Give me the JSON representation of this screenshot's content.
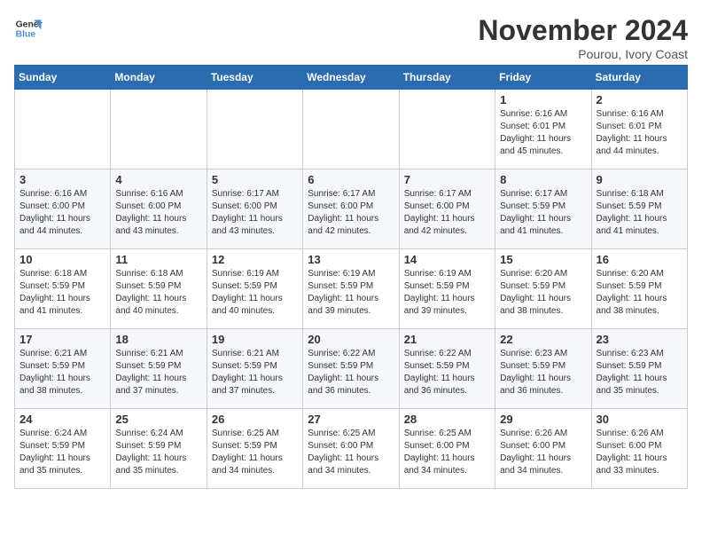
{
  "logo": {
    "line1": "General",
    "line2": "Blue"
  },
  "title": "November 2024",
  "location": "Pourou, Ivory Coast",
  "weekdays": [
    "Sunday",
    "Monday",
    "Tuesday",
    "Wednesday",
    "Thursday",
    "Friday",
    "Saturday"
  ],
  "weeks": [
    [
      {
        "day": "",
        "info": ""
      },
      {
        "day": "",
        "info": ""
      },
      {
        "day": "",
        "info": ""
      },
      {
        "day": "",
        "info": ""
      },
      {
        "day": "",
        "info": ""
      },
      {
        "day": "1",
        "info": "Sunrise: 6:16 AM\nSunset: 6:01 PM\nDaylight: 11 hours\nand 45 minutes."
      },
      {
        "day": "2",
        "info": "Sunrise: 6:16 AM\nSunset: 6:01 PM\nDaylight: 11 hours\nand 44 minutes."
      }
    ],
    [
      {
        "day": "3",
        "info": "Sunrise: 6:16 AM\nSunset: 6:00 PM\nDaylight: 11 hours\nand 44 minutes."
      },
      {
        "day": "4",
        "info": "Sunrise: 6:16 AM\nSunset: 6:00 PM\nDaylight: 11 hours\nand 43 minutes."
      },
      {
        "day": "5",
        "info": "Sunrise: 6:17 AM\nSunset: 6:00 PM\nDaylight: 11 hours\nand 43 minutes."
      },
      {
        "day": "6",
        "info": "Sunrise: 6:17 AM\nSunset: 6:00 PM\nDaylight: 11 hours\nand 42 minutes."
      },
      {
        "day": "7",
        "info": "Sunrise: 6:17 AM\nSunset: 6:00 PM\nDaylight: 11 hours\nand 42 minutes."
      },
      {
        "day": "8",
        "info": "Sunrise: 6:17 AM\nSunset: 5:59 PM\nDaylight: 11 hours\nand 41 minutes."
      },
      {
        "day": "9",
        "info": "Sunrise: 6:18 AM\nSunset: 5:59 PM\nDaylight: 11 hours\nand 41 minutes."
      }
    ],
    [
      {
        "day": "10",
        "info": "Sunrise: 6:18 AM\nSunset: 5:59 PM\nDaylight: 11 hours\nand 41 minutes."
      },
      {
        "day": "11",
        "info": "Sunrise: 6:18 AM\nSunset: 5:59 PM\nDaylight: 11 hours\nand 40 minutes."
      },
      {
        "day": "12",
        "info": "Sunrise: 6:19 AM\nSunset: 5:59 PM\nDaylight: 11 hours\nand 40 minutes."
      },
      {
        "day": "13",
        "info": "Sunrise: 6:19 AM\nSunset: 5:59 PM\nDaylight: 11 hours\nand 39 minutes."
      },
      {
        "day": "14",
        "info": "Sunrise: 6:19 AM\nSunset: 5:59 PM\nDaylight: 11 hours\nand 39 minutes."
      },
      {
        "day": "15",
        "info": "Sunrise: 6:20 AM\nSunset: 5:59 PM\nDaylight: 11 hours\nand 38 minutes."
      },
      {
        "day": "16",
        "info": "Sunrise: 6:20 AM\nSunset: 5:59 PM\nDaylight: 11 hours\nand 38 minutes."
      }
    ],
    [
      {
        "day": "17",
        "info": "Sunrise: 6:21 AM\nSunset: 5:59 PM\nDaylight: 11 hours\nand 38 minutes."
      },
      {
        "day": "18",
        "info": "Sunrise: 6:21 AM\nSunset: 5:59 PM\nDaylight: 11 hours\nand 37 minutes."
      },
      {
        "day": "19",
        "info": "Sunrise: 6:21 AM\nSunset: 5:59 PM\nDaylight: 11 hours\nand 37 minutes."
      },
      {
        "day": "20",
        "info": "Sunrise: 6:22 AM\nSunset: 5:59 PM\nDaylight: 11 hours\nand 36 minutes."
      },
      {
        "day": "21",
        "info": "Sunrise: 6:22 AM\nSunset: 5:59 PM\nDaylight: 11 hours\nand 36 minutes."
      },
      {
        "day": "22",
        "info": "Sunrise: 6:23 AM\nSunset: 5:59 PM\nDaylight: 11 hours\nand 36 minutes."
      },
      {
        "day": "23",
        "info": "Sunrise: 6:23 AM\nSunset: 5:59 PM\nDaylight: 11 hours\nand 35 minutes."
      }
    ],
    [
      {
        "day": "24",
        "info": "Sunrise: 6:24 AM\nSunset: 5:59 PM\nDaylight: 11 hours\nand 35 minutes."
      },
      {
        "day": "25",
        "info": "Sunrise: 6:24 AM\nSunset: 5:59 PM\nDaylight: 11 hours\nand 35 minutes."
      },
      {
        "day": "26",
        "info": "Sunrise: 6:25 AM\nSunset: 5:59 PM\nDaylight: 11 hours\nand 34 minutes."
      },
      {
        "day": "27",
        "info": "Sunrise: 6:25 AM\nSunset: 6:00 PM\nDaylight: 11 hours\nand 34 minutes."
      },
      {
        "day": "28",
        "info": "Sunrise: 6:25 AM\nSunset: 6:00 PM\nDaylight: 11 hours\nand 34 minutes."
      },
      {
        "day": "29",
        "info": "Sunrise: 6:26 AM\nSunset: 6:00 PM\nDaylight: 11 hours\nand 34 minutes."
      },
      {
        "day": "30",
        "info": "Sunrise: 6:26 AM\nSunset: 6:00 PM\nDaylight: 11 hours\nand 33 minutes."
      }
    ]
  ]
}
